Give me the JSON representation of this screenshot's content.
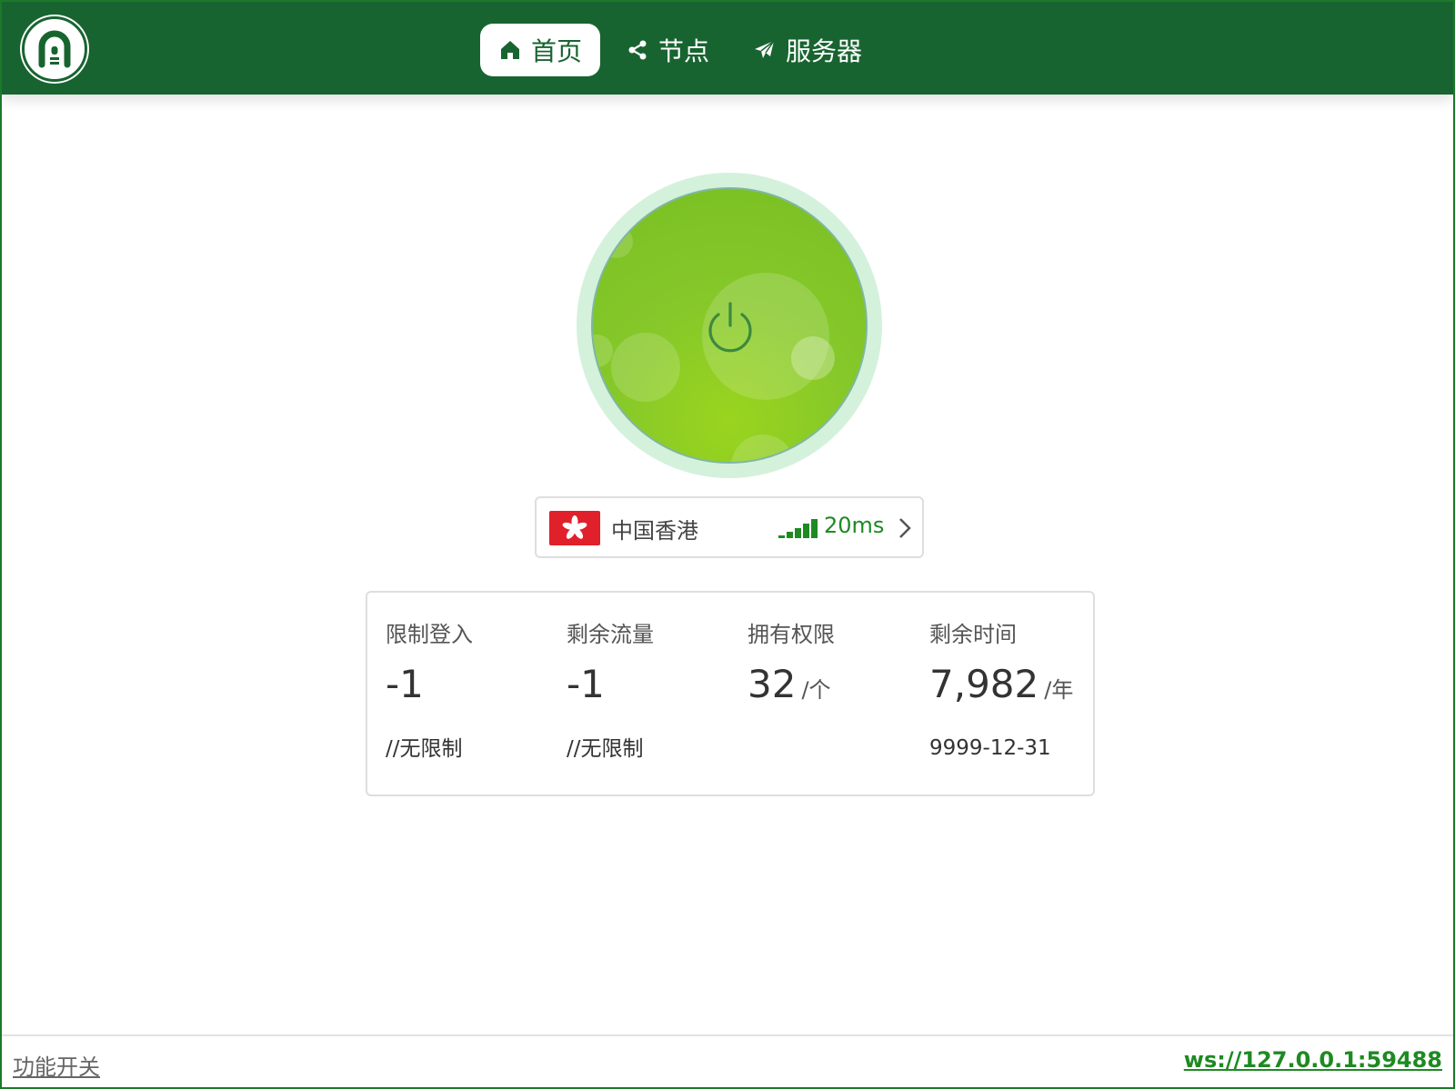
{
  "colors": {
    "header_bg": "#186430",
    "accent_green": "#1e8a22",
    "power_green": "#86c82a",
    "power_ring": "#d4f1dc",
    "flag_red": "#e0202a"
  },
  "header": {
    "logo_icon": "tunnel-logo-icon",
    "nav": [
      {
        "label": "首页",
        "icon": "home-icon",
        "active": true
      },
      {
        "label": "节点",
        "icon": "share-icon",
        "active": false
      },
      {
        "label": "服务器",
        "icon": "send-icon",
        "active": false
      }
    ]
  },
  "power": {
    "icon": "power-icon"
  },
  "node": {
    "flag_icon": "hong-kong-flag-icon",
    "name": "中国香港",
    "signal_icon": "signal-bars-icon",
    "latency": "20ms"
  },
  "stats": [
    {
      "label": "限制登入",
      "value": "-1",
      "unit": "",
      "note": "//无限制"
    },
    {
      "label": "剩余流量",
      "value": "-1",
      "unit": "",
      "note": "//无限制"
    },
    {
      "label": "拥有权限",
      "value": "32",
      "unit": "/个",
      "note": ""
    },
    {
      "label": "剩余时间",
      "value": "7,982",
      "unit": "/年",
      "note": "9999-12-31"
    }
  ],
  "footer": {
    "left_link": "功能开关",
    "right_link": "ws://127.0.0.1:59488"
  }
}
